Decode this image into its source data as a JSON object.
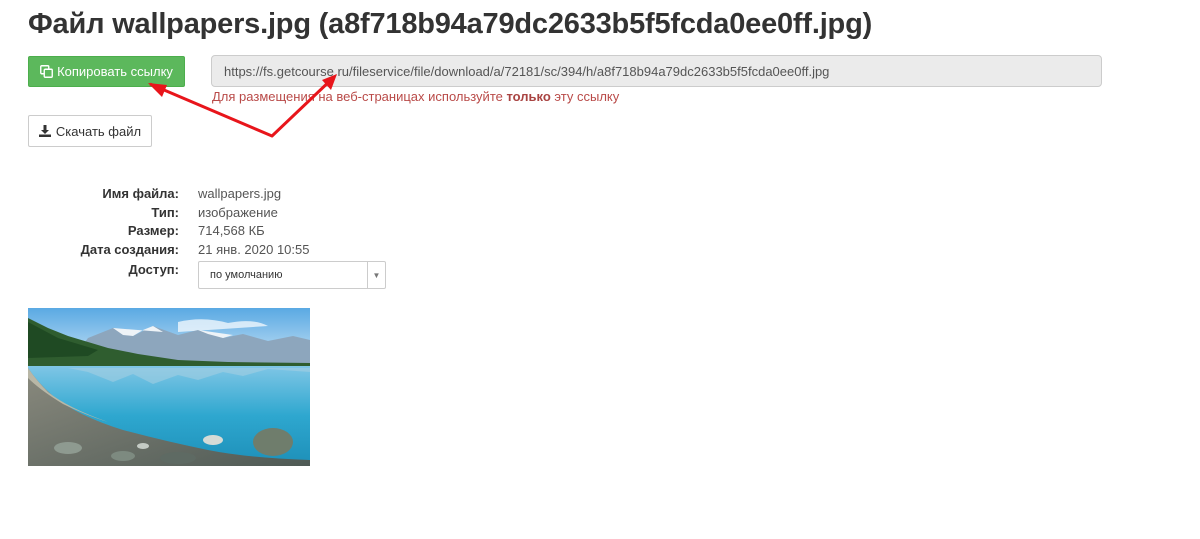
{
  "page": {
    "title": "Файл wallpapers.jpg (a8f718b94a79dc2633b5f5fcda0ee0ff.jpg)"
  },
  "actions": {
    "copy_link_label": "Копировать ссылку",
    "copy_icon": "copy-icon",
    "download_label": "Скачать файл",
    "download_icon": "download-icon"
  },
  "link": {
    "url": "https://fs.getcourse.ru/fileservice/file/download/a/72181/sc/394/h/a8f718b94a79dc2633b5f5fcda0ee0ff.jpg",
    "hint_before": "Для размещения на веб-страницах используйте ",
    "hint_bold": "только",
    "hint_after": " эту ссылку"
  },
  "info": {
    "filename_label": "Имя файла:",
    "filename_value": "wallpapers.jpg",
    "type_label": "Тип:",
    "type_value": "изображение",
    "size_label": "Размер:",
    "size_value": "714,568 КБ",
    "created_label": "Дата создания:",
    "created_value": "21 янв. 2020 10:55",
    "access_label": "Доступ:",
    "access_value": "по умолчанию"
  },
  "colors": {
    "primary_button": "#5cb85c",
    "hint_text": "#b94a48",
    "annotation_arrow": "#e8151b"
  }
}
